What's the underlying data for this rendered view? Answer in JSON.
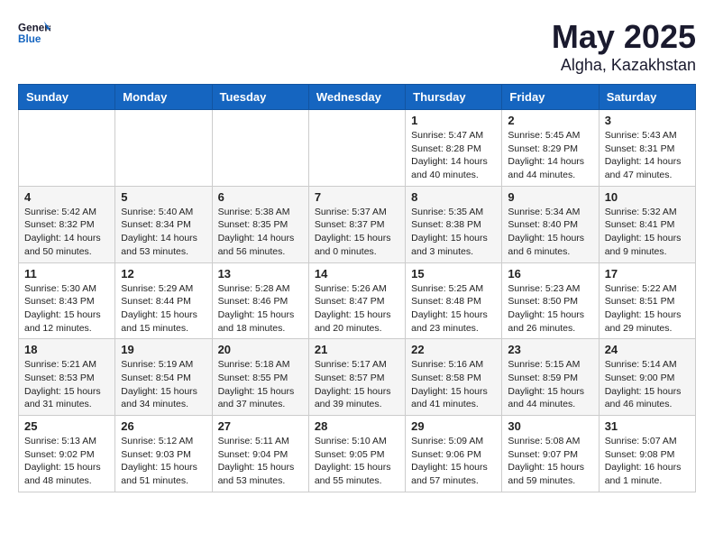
{
  "header": {
    "logo_general": "General",
    "logo_blue": "Blue",
    "month": "May 2025",
    "location": "Algha, Kazakhstan"
  },
  "weekdays": [
    "Sunday",
    "Monday",
    "Tuesday",
    "Wednesday",
    "Thursday",
    "Friday",
    "Saturday"
  ],
  "weeks": [
    [
      {
        "day": "",
        "info": ""
      },
      {
        "day": "",
        "info": ""
      },
      {
        "day": "",
        "info": ""
      },
      {
        "day": "",
        "info": ""
      },
      {
        "day": "1",
        "info": "Sunrise: 5:47 AM\nSunset: 8:28 PM\nDaylight: 14 hours\nand 40 minutes."
      },
      {
        "day": "2",
        "info": "Sunrise: 5:45 AM\nSunset: 8:29 PM\nDaylight: 14 hours\nand 44 minutes."
      },
      {
        "day": "3",
        "info": "Sunrise: 5:43 AM\nSunset: 8:31 PM\nDaylight: 14 hours\nand 47 minutes."
      }
    ],
    [
      {
        "day": "4",
        "info": "Sunrise: 5:42 AM\nSunset: 8:32 PM\nDaylight: 14 hours\nand 50 minutes."
      },
      {
        "day": "5",
        "info": "Sunrise: 5:40 AM\nSunset: 8:34 PM\nDaylight: 14 hours\nand 53 minutes."
      },
      {
        "day": "6",
        "info": "Sunrise: 5:38 AM\nSunset: 8:35 PM\nDaylight: 14 hours\nand 56 minutes."
      },
      {
        "day": "7",
        "info": "Sunrise: 5:37 AM\nSunset: 8:37 PM\nDaylight: 15 hours\nand 0 minutes."
      },
      {
        "day": "8",
        "info": "Sunrise: 5:35 AM\nSunset: 8:38 PM\nDaylight: 15 hours\nand 3 minutes."
      },
      {
        "day": "9",
        "info": "Sunrise: 5:34 AM\nSunset: 8:40 PM\nDaylight: 15 hours\nand 6 minutes."
      },
      {
        "day": "10",
        "info": "Sunrise: 5:32 AM\nSunset: 8:41 PM\nDaylight: 15 hours\nand 9 minutes."
      }
    ],
    [
      {
        "day": "11",
        "info": "Sunrise: 5:30 AM\nSunset: 8:43 PM\nDaylight: 15 hours\nand 12 minutes."
      },
      {
        "day": "12",
        "info": "Sunrise: 5:29 AM\nSunset: 8:44 PM\nDaylight: 15 hours\nand 15 minutes."
      },
      {
        "day": "13",
        "info": "Sunrise: 5:28 AM\nSunset: 8:46 PM\nDaylight: 15 hours\nand 18 minutes."
      },
      {
        "day": "14",
        "info": "Sunrise: 5:26 AM\nSunset: 8:47 PM\nDaylight: 15 hours\nand 20 minutes."
      },
      {
        "day": "15",
        "info": "Sunrise: 5:25 AM\nSunset: 8:48 PM\nDaylight: 15 hours\nand 23 minutes."
      },
      {
        "day": "16",
        "info": "Sunrise: 5:23 AM\nSunset: 8:50 PM\nDaylight: 15 hours\nand 26 minutes."
      },
      {
        "day": "17",
        "info": "Sunrise: 5:22 AM\nSunset: 8:51 PM\nDaylight: 15 hours\nand 29 minutes."
      }
    ],
    [
      {
        "day": "18",
        "info": "Sunrise: 5:21 AM\nSunset: 8:53 PM\nDaylight: 15 hours\nand 31 minutes."
      },
      {
        "day": "19",
        "info": "Sunrise: 5:19 AM\nSunset: 8:54 PM\nDaylight: 15 hours\nand 34 minutes."
      },
      {
        "day": "20",
        "info": "Sunrise: 5:18 AM\nSunset: 8:55 PM\nDaylight: 15 hours\nand 37 minutes."
      },
      {
        "day": "21",
        "info": "Sunrise: 5:17 AM\nSunset: 8:57 PM\nDaylight: 15 hours\nand 39 minutes."
      },
      {
        "day": "22",
        "info": "Sunrise: 5:16 AM\nSunset: 8:58 PM\nDaylight: 15 hours\nand 41 minutes."
      },
      {
        "day": "23",
        "info": "Sunrise: 5:15 AM\nSunset: 8:59 PM\nDaylight: 15 hours\nand 44 minutes."
      },
      {
        "day": "24",
        "info": "Sunrise: 5:14 AM\nSunset: 9:00 PM\nDaylight: 15 hours\nand 46 minutes."
      }
    ],
    [
      {
        "day": "25",
        "info": "Sunrise: 5:13 AM\nSunset: 9:02 PM\nDaylight: 15 hours\nand 48 minutes."
      },
      {
        "day": "26",
        "info": "Sunrise: 5:12 AM\nSunset: 9:03 PM\nDaylight: 15 hours\nand 51 minutes."
      },
      {
        "day": "27",
        "info": "Sunrise: 5:11 AM\nSunset: 9:04 PM\nDaylight: 15 hours\nand 53 minutes."
      },
      {
        "day": "28",
        "info": "Sunrise: 5:10 AM\nSunset: 9:05 PM\nDaylight: 15 hours\nand 55 minutes."
      },
      {
        "day": "29",
        "info": "Sunrise: 5:09 AM\nSunset: 9:06 PM\nDaylight: 15 hours\nand 57 minutes."
      },
      {
        "day": "30",
        "info": "Sunrise: 5:08 AM\nSunset: 9:07 PM\nDaylight: 15 hours\nand 59 minutes."
      },
      {
        "day": "31",
        "info": "Sunrise: 5:07 AM\nSunset: 9:08 PM\nDaylight: 16 hours\nand 1 minute."
      }
    ]
  ]
}
